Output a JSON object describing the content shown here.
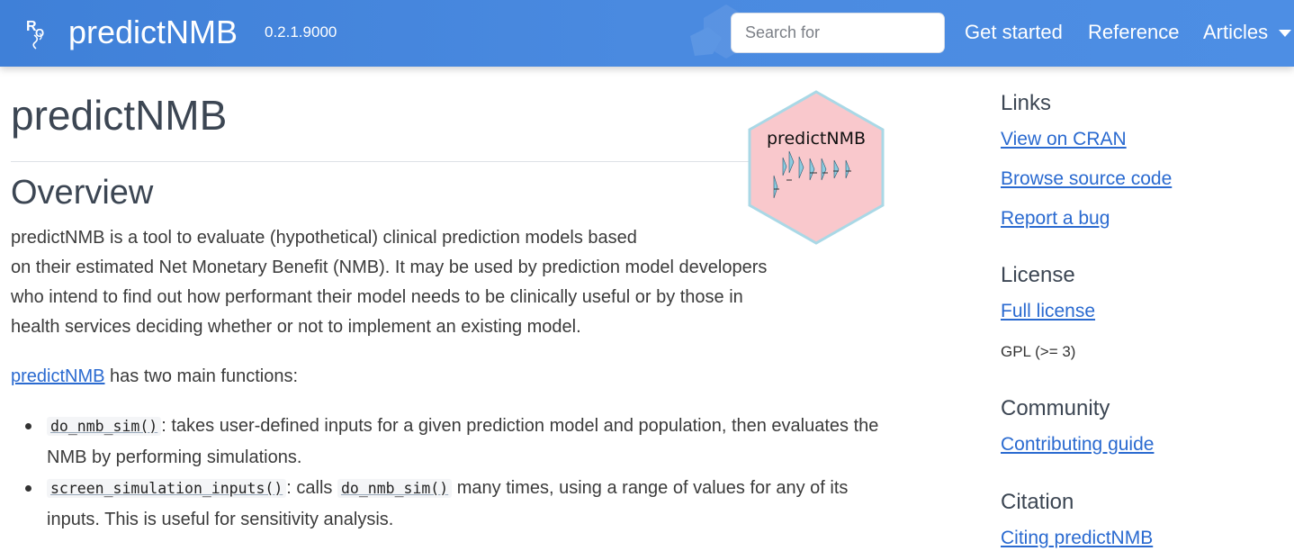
{
  "navbar": {
    "brand": "predictNMB",
    "version": "0.2.1.9000",
    "search_placeholder": "Search for",
    "links": [
      "Get started",
      "Reference",
      "Articles"
    ]
  },
  "main": {
    "title": "predictNMB",
    "overview_heading": "Overview",
    "intro_lines": [
      "predictNMB is a tool to evaluate (hypothetical) clinical prediction models based",
      "on their estimated Net Monetary Benefit (NMB). It may be used by prediction model developers",
      "who intend to find out how performant their model needs to be clinically useful or by those in",
      "health services deciding whether or not to implement an existing model."
    ],
    "functions_link": "predictNMB",
    "functions_text": " has two main functions:",
    "bullets": [
      {
        "code": "do_nmb_sim()",
        "text": ": takes user-defined inputs for a given prediction model and population, then evaluates the NMB by performing simulations."
      },
      {
        "code": "screen_simulation_inputs()",
        "text_before": ": calls ",
        "code2": "do_nmb_sim()",
        "text_after": " many times, using a range of values for any of its inputs. This is useful for sensitivity analysis."
      }
    ]
  },
  "hex_logo": {
    "text": "predictNMB",
    "fill": "#f9c8cc",
    "border": "#a9d8e6"
  },
  "sidebar": {
    "links_heading": "Links",
    "links": [
      "View on CRAN",
      "Browse source code",
      "Report a bug"
    ],
    "license_heading": "License",
    "license_link": "Full license",
    "license_text": "GPL (>= 3)",
    "community_heading": "Community",
    "community_link": "Contributing guide",
    "citation_heading": "Citation",
    "citation_link": "Citing predictNMB"
  },
  "colors": {
    "navbar": "#4a8ae0",
    "link": "#2a6ad0",
    "heading": "#3c4653"
  }
}
